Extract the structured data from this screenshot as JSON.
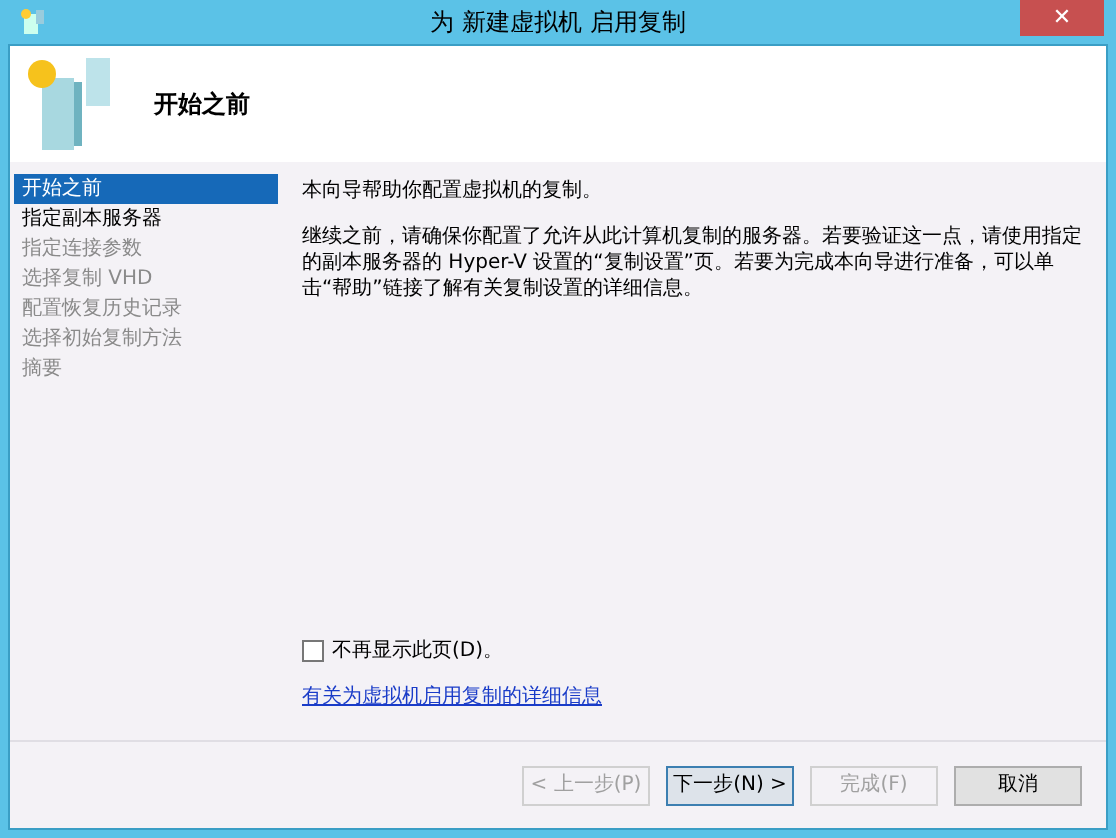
{
  "window": {
    "title": "为 新建虚拟机 启用复制",
    "close": "✕"
  },
  "header": {
    "title": "开始之前"
  },
  "sidebar": {
    "items": [
      {
        "label": "开始之前",
        "selected": true,
        "disabled": false
      },
      {
        "label": "指定副本服务器",
        "selected": false,
        "disabled": false
      },
      {
        "label": "指定连接参数",
        "selected": false,
        "disabled": true
      },
      {
        "label": "选择复制 VHD",
        "selected": false,
        "disabled": true
      },
      {
        "label": "配置恢复历史记录",
        "selected": false,
        "disabled": true
      },
      {
        "label": "选择初始复制方法",
        "selected": false,
        "disabled": true
      },
      {
        "label": "摘要",
        "selected": false,
        "disabled": true
      }
    ]
  },
  "content": {
    "paragraphs": [
      "本向导帮助你配置虚拟机的复制。",
      "继续之前，请确保你配置了允许从此计算机复制的服务器。若要验证这一点，请使用指定的副本服务器的 Hyper-V 设置的“复制设置”页。若要为完成本向导进行准备，可以单击“帮助”链接了解有关复制设置的详细信息。"
    ],
    "checkbox": {
      "label": "不再显示此页(D)。",
      "checked": false
    },
    "link": "有关为虚拟机启用复制的详细信息"
  },
  "buttons": [
    {
      "label": "< 上一步(P)",
      "disabled": true,
      "default": false
    },
    {
      "label": "下一步(N) >",
      "disabled": false,
      "default": true
    },
    {
      "label": "完成(F)",
      "disabled": true,
      "default": false
    },
    {
      "label": "取消",
      "disabled": false,
      "default": false
    }
  ]
}
